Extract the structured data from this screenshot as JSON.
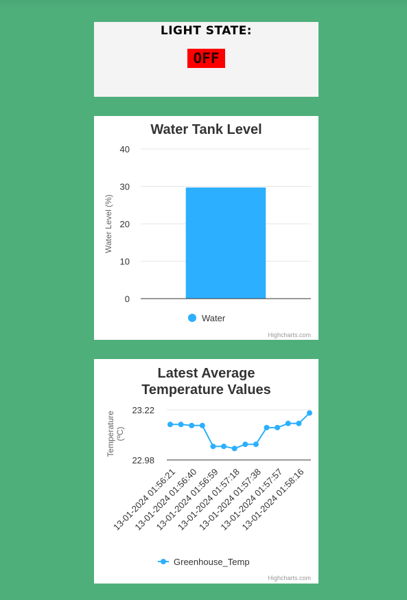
{
  "light": {
    "title": "LIGHT STATE:",
    "state": "OFF",
    "state_color": "#ff0000"
  },
  "credit": "Highcharts.com",
  "chart_data": [
    {
      "type": "bar",
      "title": "Water Tank Level",
      "ylabel": "Water Level (%)",
      "xlabel": "",
      "ylim": [
        0,
        40
      ],
      "yticks": [
        0,
        10,
        20,
        30,
        40
      ],
      "categories": [
        ""
      ],
      "series": [
        {
          "name": "Water",
          "values": [
            29.7
          ],
          "color": "#2caffe"
        }
      ],
      "legend": "bottom-center",
      "grid": true
    },
    {
      "type": "line",
      "title": "Latest Average Temperature Values",
      "title_lines": [
        "Latest Average",
        "Temperature Values"
      ],
      "ylabel_lines": [
        "Temperature",
        "(ºC)"
      ],
      "xlabel": "",
      "ylim": [
        22.98,
        23.22
      ],
      "yticks": [
        22.98,
        23.22
      ],
      "x_labels": [
        "13-01-2024 01:56:21",
        "13-01-2024 01:56:40",
        "13-01-2024 01:56:59",
        "13-01-2024 01:57:18",
        "13-01-2024 01:57:38",
        "13-01-2024 01:57:57",
        "13-01-2024 01:58:16"
      ],
      "series": [
        {
          "name": "Greenhouse_Temp",
          "color": "#2caffe",
          "values": [
            23.15,
            23.15,
            23.145,
            23.145,
            23.045,
            23.045,
            23.035,
            23.055,
            23.055,
            23.135,
            23.135,
            23.155,
            23.155,
            23.205
          ]
        }
      ],
      "legend": "bottom-center",
      "grid": false
    }
  ]
}
